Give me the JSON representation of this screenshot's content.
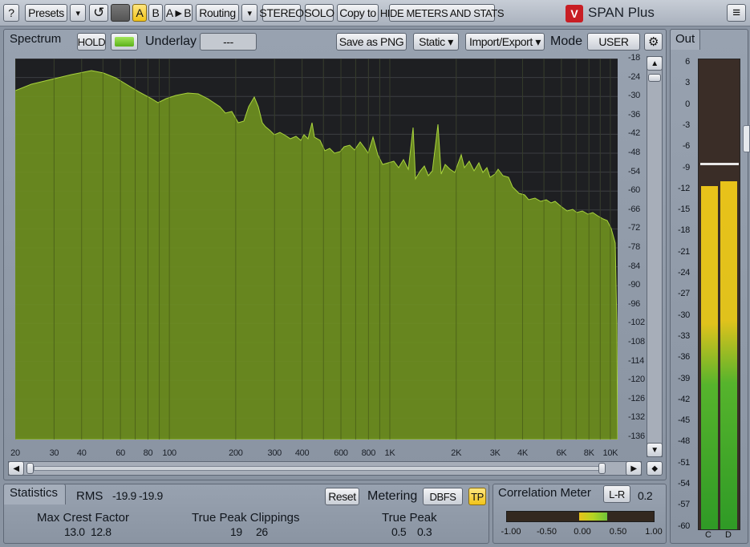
{
  "toolbar": {
    "help": "?",
    "presets": "Presets",
    "dropdown": "▾",
    "undo": "↺",
    "a": "A",
    "b": "B",
    "a_to_b": "A►B",
    "routing": "Routing",
    "stereo": "STEREO",
    "solo": "SOLO",
    "copy_to": "Copy to",
    "hide_meters": "HIDE METERS AND STATS",
    "app_name": "SPAN Plus",
    "menu": "≡"
  },
  "spectrum": {
    "title": "Spectrum",
    "hold": "HOLD",
    "underlay_label": "Underlay",
    "underlay_value": "---",
    "save_png": "Save as PNG",
    "static": "Static ▾",
    "import_export": "Import/Export ▾",
    "mode_label": "Mode",
    "mode_value": "USER",
    "y_ticks": [
      "-18",
      "-24",
      "-30",
      "-36",
      "-42",
      "-48",
      "-54",
      "-60",
      "-66",
      "-72",
      "-78",
      "-84",
      "-90",
      "-96",
      "-102",
      "-108",
      "-114",
      "-120",
      "-126",
      "-132",
      "-136"
    ],
    "x_ticks": [
      "20",
      "30",
      "40",
      "60",
      "80",
      "100",
      "200",
      "300",
      "400",
      "600",
      "800",
      "1K",
      "2K",
      "3K",
      "4K",
      "6K",
      "8K",
      "10K"
    ]
  },
  "out": {
    "title": "Out",
    "ticks": [
      "6",
      "3",
      "0",
      "-3",
      "-6",
      "-9",
      "-12",
      "-15",
      "-18",
      "-21",
      "-24",
      "-27",
      "-30",
      "-33",
      "-36",
      "-39",
      "-42",
      "-45",
      "-48",
      "-51",
      "-54",
      "-57",
      "-60"
    ],
    "channel_left": "C",
    "channel_right": "D",
    "level_left_db": -11.5,
    "level_right_db": -10.8,
    "peak_db": -8.2
  },
  "statistics": {
    "title": "Statistics",
    "rms_label": "RMS",
    "rms_l": "-19.9",
    "rms_r": "-19.9",
    "reset": "Reset",
    "metering_label": "Metering",
    "metering_value": "DBFS",
    "tp": "TP",
    "max_crest_label": "Max Crest Factor",
    "max_crest_l": "13.0",
    "max_crest_r": "12.8",
    "tp_clip_label": "True Peak Clippings",
    "tp_clip_l": "19",
    "tp_clip_r": "26",
    "true_peak_label": "True Peak",
    "true_peak_l": "0.5",
    "true_peak_r": "0.3"
  },
  "correlation": {
    "title": "Correlation Meter",
    "lr_label": "L-R",
    "lr_value": "0.2",
    "ticks": [
      "-1.00",
      "-0.50",
      "0.00",
      "0.50",
      "1.00"
    ]
  },
  "colors": {
    "accent_green": "#7aa829",
    "meter_yellow": "#e8c21a",
    "meter_green": "#3fae2a"
  }
}
